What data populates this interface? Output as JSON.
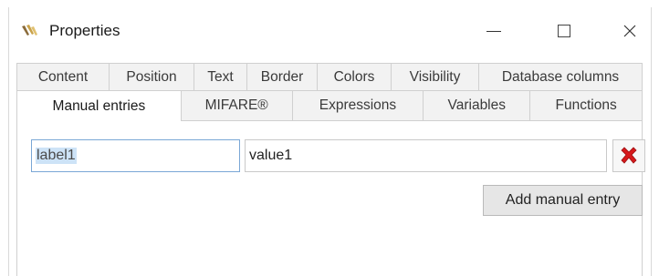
{
  "window": {
    "title": "Properties",
    "icon": "app-logo-icon",
    "controls": {
      "minimize": "minimize-icon",
      "maximize": "maximize-icon",
      "close": "close-icon"
    }
  },
  "tabs": {
    "row1": [
      {
        "label": "Content"
      },
      {
        "label": "Position"
      },
      {
        "label": "Text"
      },
      {
        "label": "Border"
      },
      {
        "label": "Colors"
      },
      {
        "label": "Visibility"
      },
      {
        "label": "Database columns"
      }
    ],
    "row2": [
      {
        "label": "Manual entries",
        "active": true
      },
      {
        "label": "MIFARE®"
      },
      {
        "label": "Expressions"
      },
      {
        "label": "Variables"
      },
      {
        "label": "Functions"
      }
    ]
  },
  "manual_entry": {
    "label_value": "label1",
    "value_value": "value1",
    "delete_icon": "red-x-icon",
    "add_label": "Add manual entry"
  },
  "colors": {
    "delete_red": "#d7191c",
    "selection": "#cde3f7",
    "focus_border": "#7aa7d6"
  }
}
